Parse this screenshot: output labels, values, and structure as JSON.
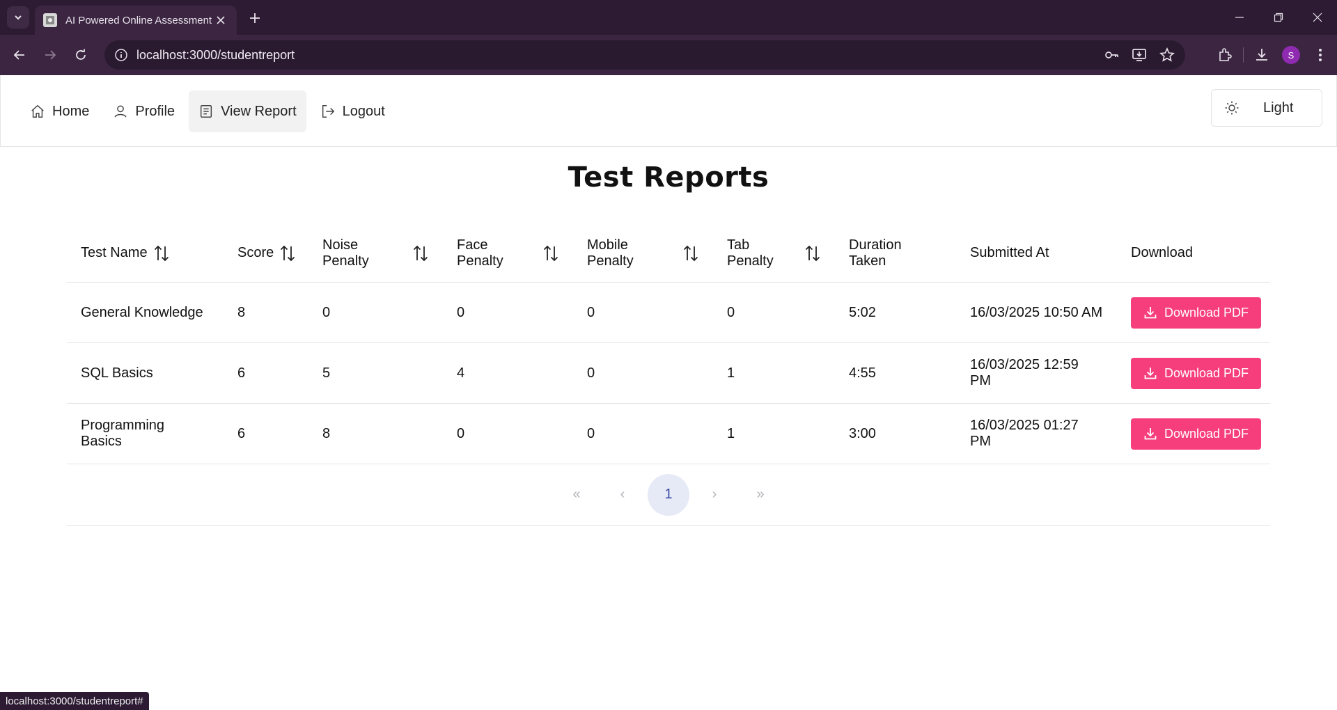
{
  "browser": {
    "tab_title": "AI Powered Online Assessment",
    "url": "localhost:3000/studentreport",
    "profile_initial": "S",
    "status_url": "localhost:3000/studentreport#"
  },
  "nav": {
    "items": [
      {
        "label": "Home",
        "icon": "home-icon"
      },
      {
        "label": "Profile",
        "icon": "user-icon"
      },
      {
        "label": "View Report",
        "icon": "report-icon"
      },
      {
        "label": "Logout",
        "icon": "logout-icon"
      }
    ],
    "active": "View Report",
    "theme_label": "Light"
  },
  "page": {
    "title": "Test Reports"
  },
  "table": {
    "headers": [
      "Test Name",
      "Score",
      "Noise Penalty",
      "Face Penalty",
      "Mobile Penalty",
      "Tab Penalty",
      "Duration Taken",
      "Submitted At",
      "Download"
    ],
    "rows": [
      [
        "General Knowledge",
        "8",
        "0",
        "0",
        "0",
        "0",
        "5:02",
        "16/03/2025 10:50 AM"
      ],
      [
        "SQL Basics",
        "6",
        "5",
        "4",
        "0",
        "1",
        "4:55",
        "16/03/2025 12:59 PM"
      ],
      [
        "Programming Basics",
        "6",
        "8",
        "0",
        "0",
        "1",
        "3:00",
        "16/03/2025 01:27 PM"
      ]
    ],
    "download_label": "Download PDF"
  },
  "pagination": {
    "first": "«",
    "prev": "‹",
    "current": "1",
    "next": "›",
    "last": "»"
  },
  "colors": {
    "accent": "#f73e7d",
    "chrome": "#2d1b33",
    "page_active": "#e6eaf6"
  }
}
